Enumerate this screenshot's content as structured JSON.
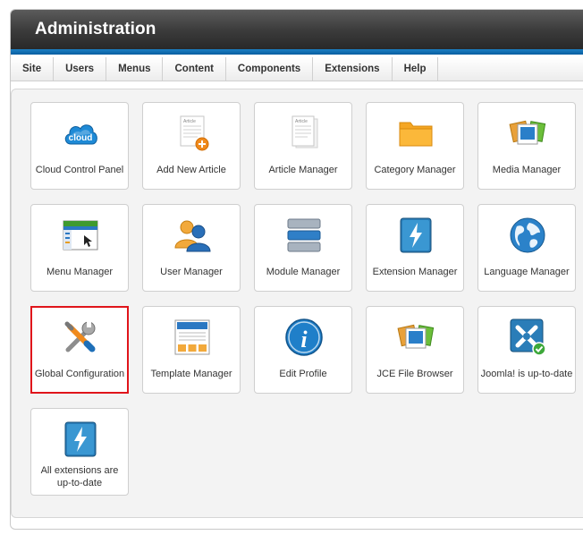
{
  "header": {
    "title": "Administration"
  },
  "menu": [
    "Site",
    "Users",
    "Menus",
    "Content",
    "Components",
    "Extensions",
    "Help"
  ],
  "tiles": [
    {
      "label": "Cloud Control Panel",
      "icon": "cloud-icon",
      "icon_text": "cloud"
    },
    {
      "label": "Add New Article",
      "icon": "add-article-icon",
      "icon_text": "Article"
    },
    {
      "label": "Article Manager",
      "icon": "article-manager-icon",
      "icon_text": "Article"
    },
    {
      "label": "Category Manager",
      "icon": "folder-icon"
    },
    {
      "label": "Media Manager",
      "icon": "media-icon"
    },
    {
      "label": "Menu Manager",
      "icon": "menu-manager-icon"
    },
    {
      "label": "User Manager",
      "icon": "users-icon"
    },
    {
      "label": "Module Manager",
      "icon": "module-icon"
    },
    {
      "label": "Extension Manager",
      "icon": "extension-icon"
    },
    {
      "label": "Language Manager",
      "icon": "globe-icon"
    },
    {
      "label": "Global Configuration",
      "icon": "tools-icon",
      "selected": true
    },
    {
      "label": "Template Manager",
      "icon": "template-icon"
    },
    {
      "label": "Edit Profile",
      "icon": "info-icon"
    },
    {
      "label": "JCE File Browser",
      "icon": "file-browser-icon"
    },
    {
      "label": "Joomla! is up-to-date",
      "icon": "joomla-icon"
    },
    {
      "label": "All extensions are up-to-date",
      "icon": "extension-update-icon"
    }
  ]
}
